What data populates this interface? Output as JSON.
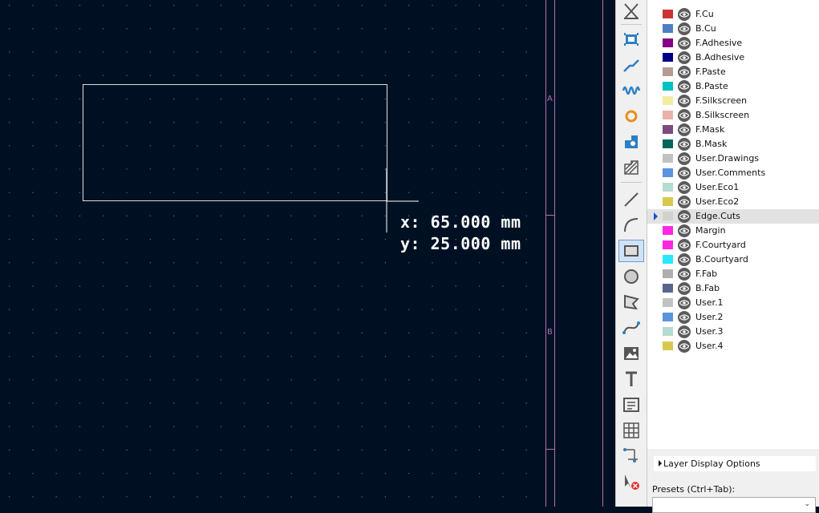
{
  "canvas": {
    "cursor_readout": {
      "x": "x: 65.000 mm",
      "y": "y: 25.000 mm"
    },
    "border_labels": [
      "A",
      "B"
    ],
    "colors": {
      "background": "#001023",
      "grid": "#5a6f86",
      "outline": "#dcdcdc",
      "border": "#b070b0"
    }
  },
  "toolbar": {
    "tools": [
      {
        "name": "cancel-tool-icon"
      },
      {
        "name": "footprint-icon"
      },
      {
        "name": "route-track-icon"
      },
      {
        "name": "tune-length-icon"
      },
      {
        "name": "via-icon"
      },
      {
        "name": "zone-icon"
      },
      {
        "name": "rule-area-icon"
      },
      {
        "name": "line-icon"
      },
      {
        "name": "arc-icon"
      },
      {
        "name": "rectangle-icon",
        "active": true
      },
      {
        "name": "circle-icon"
      },
      {
        "name": "polygon-icon"
      },
      {
        "name": "bezier-icon"
      },
      {
        "name": "image-icon"
      },
      {
        "name": "text-icon"
      },
      {
        "name": "textbox-icon"
      },
      {
        "name": "table-icon"
      },
      {
        "name": "dimension-icon"
      },
      {
        "name": "delete-tool-icon"
      }
    ]
  },
  "layers": [
    {
      "name": "F.Cu",
      "color": "#c83434"
    },
    {
      "name": "B.Cu",
      "color": "#4d7fc4"
    },
    {
      "name": "F.Adhesive",
      "color": "#840084"
    },
    {
      "name": "B.Adhesive",
      "color": "#000084"
    },
    {
      "name": "F.Paste",
      "color": "#b49c95"
    },
    {
      "name": "B.Paste",
      "color": "#00c2c2"
    },
    {
      "name": "F.Silkscreen",
      "color": "#f2eda1"
    },
    {
      "name": "B.Silkscreen",
      "color": "#e8b2a7"
    },
    {
      "name": "F.Mask",
      "color": "#7d4b7d"
    },
    {
      "name": "B.Mask",
      "color": "#02665a"
    },
    {
      "name": "User.Drawings",
      "color": "#c2c2c2"
    },
    {
      "name": "User.Comments",
      "color": "#5994dc"
    },
    {
      "name": "User.Eco1",
      "color": "#b4dbd2"
    },
    {
      "name": "User.Eco2",
      "color": "#d8c852"
    },
    {
      "name": "Edge.Cuts",
      "color": "#d0d2cd",
      "selected": true
    },
    {
      "name": "Margin",
      "color": "#ff26e2"
    },
    {
      "name": "F.Courtyard",
      "color": "#ff26e2"
    },
    {
      "name": "B.Courtyard",
      "color": "#26e9ff"
    },
    {
      "name": "F.Fab",
      "color": "#afafaf"
    },
    {
      "name": "B.Fab",
      "color": "#58658f"
    },
    {
      "name": "User.1",
      "color": "#c2c2c2"
    },
    {
      "name": "User.2",
      "color": "#5994dc"
    },
    {
      "name": "User.3",
      "color": "#b4dbd2"
    },
    {
      "name": "User.4",
      "color": "#d8c852"
    }
  ],
  "panel": {
    "layer_display_options": "Layer Display Options",
    "presets_label": "Presets (Ctrl+Tab):"
  }
}
